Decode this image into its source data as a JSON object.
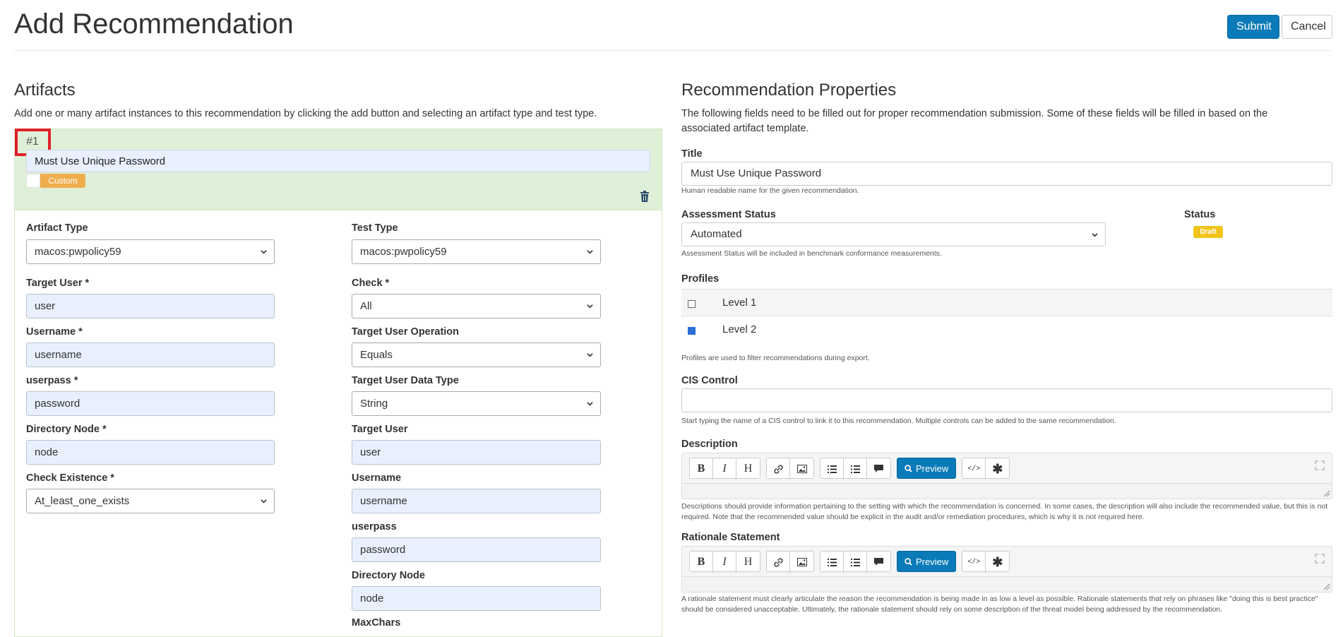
{
  "header": {
    "title": "Add Recommendation",
    "submit_label": "Submit",
    "cancel_label": "Cancel"
  },
  "artifacts": {
    "heading": "Artifacts",
    "description": "Add one or many artifact instances to this recommendation by clicking the add button and selecting an artifact type and test type.",
    "instance": {
      "number": "#1",
      "title_value": "Must Use Unique Password",
      "toggle_label": "Custom",
      "left_fields": [
        {
          "label": "Artifact Type",
          "value": "macos:pwpolicy59",
          "kind": "select"
        },
        {
          "label": "Target User *",
          "value": "user",
          "kind": "input"
        },
        {
          "label": "Username *",
          "value": "username",
          "kind": "input"
        },
        {
          "label": "userpass *",
          "value": "password",
          "kind": "input"
        },
        {
          "label": "Directory Node *",
          "value": "node",
          "kind": "input"
        },
        {
          "label": "Check Existence *",
          "value": "At_least_one_exists",
          "kind": "select"
        }
      ],
      "right_fields": [
        {
          "label": "Test Type",
          "value": "macos:pwpolicy59",
          "kind": "select"
        },
        {
          "label": "Check *",
          "value": "All",
          "kind": "select"
        },
        {
          "label": "Target User Operation",
          "value": "Equals",
          "kind": "select"
        },
        {
          "label": "Target User Data Type",
          "value": "String",
          "kind": "select"
        },
        {
          "label": "Target User",
          "value": "user",
          "kind": "input"
        },
        {
          "label": "Username",
          "value": "username",
          "kind": "input"
        },
        {
          "label": "userpass",
          "value": "password",
          "kind": "input"
        },
        {
          "label": "Directory Node",
          "value": "node",
          "kind": "input"
        },
        {
          "label": "MaxChars",
          "value": "",
          "kind": "label-only"
        }
      ]
    }
  },
  "properties": {
    "heading": "Recommendation Properties",
    "description": "The following fields need to be filled out for proper recommendation submission. Some of these fields will be filled in based on the associated artifact template.",
    "title_label": "Title",
    "title_value": "Must Use Unique Password",
    "title_help": "Human readable name for the given recommendation.",
    "assessment_label": "Assessment Status",
    "assessment_value": "Automated",
    "assessment_help": "Assessment Status will be included in benchmark conformance measurements.",
    "status_label": "Status",
    "status_badge": "Draft",
    "profiles_label": "Profiles",
    "profiles": [
      {
        "name": "Level 1",
        "checked": false
      },
      {
        "name": "Level 2",
        "checked": true
      }
    ],
    "profiles_help": "Profiles are used to filter recommendations during export.",
    "cis_label": "CIS Control",
    "cis_value": "",
    "cis_help": "Start typing the name of a CIS control to link it to this recommendation. Multiple controls can be added to the same recommendation.",
    "description_label": "Description",
    "description_help": "Descriptions should provide information pertaining to the setting with which the recommendation is concerned. In some cases, the description will also include the recommended value, but this is not required. Note that the recommended value should be explicit in the audit and/or remediation procedures, which is why it is not required here.",
    "rationale_label": "Rationale Statement",
    "rationale_help": "A rationale statement must clearly articulate the reason the recommendation is being made in as low a level as possible. Rationale statements that rely on phrases like \"doing this is best practice\" should be considered unacceptable. Ultimately, the rationale statement should rely on some description of the threat model being addressed by the recommendation.",
    "editor_toolbar": {
      "bold": "B",
      "italic": "I",
      "heading": "H",
      "preview": "Preview"
    }
  },
  "colors": {
    "primary": "#0a7ab8",
    "artifact_header_bg": "#dff0d8",
    "toggle_orange": "#f0ad4e",
    "draft_yellow": "#f0c419",
    "highlight_red": "#e0202a",
    "autofill_blue": "#e8f0fe"
  },
  "icons": [
    "trash-icon",
    "chevron-down-icon",
    "link-icon",
    "image-icon",
    "list-icon",
    "comment-icon",
    "search-icon",
    "code-icon",
    "asterisk-icon",
    "expand-icon"
  ]
}
